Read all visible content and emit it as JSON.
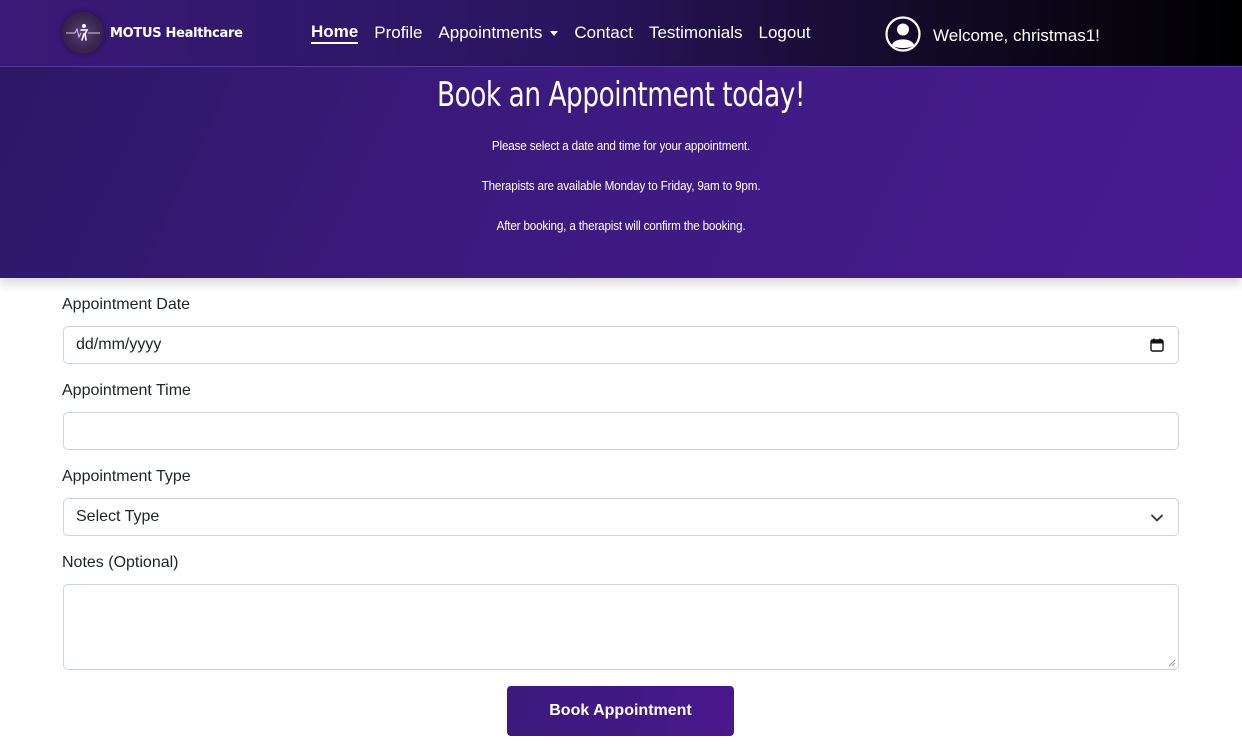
{
  "brand": {
    "name": "MOTUS Healthcare"
  },
  "nav": {
    "items": [
      {
        "label": "Home",
        "active": true
      },
      {
        "label": "Profile"
      },
      {
        "label": "Appointments",
        "dropdown": true
      },
      {
        "label": "Contact"
      },
      {
        "label": "Testimonials"
      },
      {
        "label": "Logout"
      }
    ]
  },
  "user": {
    "welcome": "Welcome, christmas1!",
    "icon": "user-circle-icon"
  },
  "hero": {
    "title": "Book an Appointment today!",
    "lines": [
      "Please select a date and time for your appointment.",
      "Therapists are available Monday to Friday, 9am to 9pm.",
      "After booking, a therapist will confirm the booking."
    ]
  },
  "form": {
    "date_label": "Appointment Date",
    "date_placeholder": "dd/mm/yyyy",
    "time_label": "Appointment Time",
    "time_value": "",
    "type_label": "Appointment Type",
    "type_value": "Select Type",
    "notes_label": "Notes (Optional)",
    "notes_value": "",
    "submit_label": "Book Appointment"
  },
  "colors": {
    "nav_start": "#3a1a78",
    "nav_end": "#000000",
    "hero": "#3b1a7e",
    "button": "#3a1a7c"
  }
}
